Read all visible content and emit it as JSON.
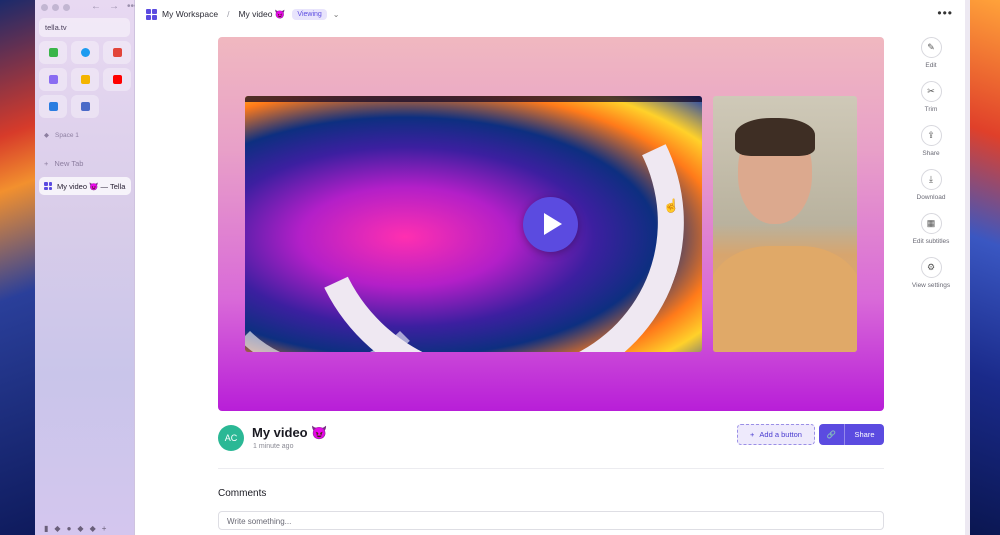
{
  "sidebar": {
    "url": "tella.tv",
    "favorites": [
      {
        "icon": "sheets-icon",
        "color": "#3ab54a"
      },
      {
        "icon": "twitter-icon",
        "color": "#1d9bf0"
      },
      {
        "icon": "bird-icon",
        "color": "#e2453a"
      },
      {
        "icon": "tella-icon",
        "color": "#8a6cf2"
      },
      {
        "icon": "drive-icon",
        "color": "#f4b400"
      },
      {
        "icon": "youtube-icon",
        "color": "#ff0000"
      },
      {
        "icon": "files-icon",
        "color": "#2a7de1"
      },
      {
        "icon": "app-icon",
        "color": "#4a6ac8"
      }
    ],
    "space_label": "Space 1",
    "new_tab_label": "New Tab",
    "active_tab_label": "My video 😈 — Tella"
  },
  "topbar": {
    "workspace": "My Workspace",
    "separator": "/",
    "video_name": "My video 😈",
    "badge": "Viewing",
    "more": "•••"
  },
  "side_actions": [
    {
      "label": "Edit",
      "icon": "pencil-icon",
      "glyph": "✎"
    },
    {
      "label": "Trim",
      "icon": "scissors-icon",
      "glyph": "✂"
    },
    {
      "label": "Share",
      "icon": "share-icon",
      "glyph": "⇪"
    },
    {
      "label": "Download",
      "icon": "download-icon",
      "glyph": "⤓"
    },
    {
      "label": "Edit subtitles",
      "icon": "subtitles-icon",
      "glyph": "▦"
    },
    {
      "label": "View settings",
      "icon": "gear-icon",
      "glyph": "⚙"
    }
  ],
  "video": {
    "avatar_initials": "AC",
    "title": "My video 😈",
    "time": "1 minute ago",
    "add_button_label": "Add a button",
    "share_label": "Share"
  },
  "comments": {
    "heading": "Comments",
    "placeholder": "Write something..."
  },
  "colors": {
    "accent": "#5b4be0",
    "avatar": "#2bb895"
  }
}
